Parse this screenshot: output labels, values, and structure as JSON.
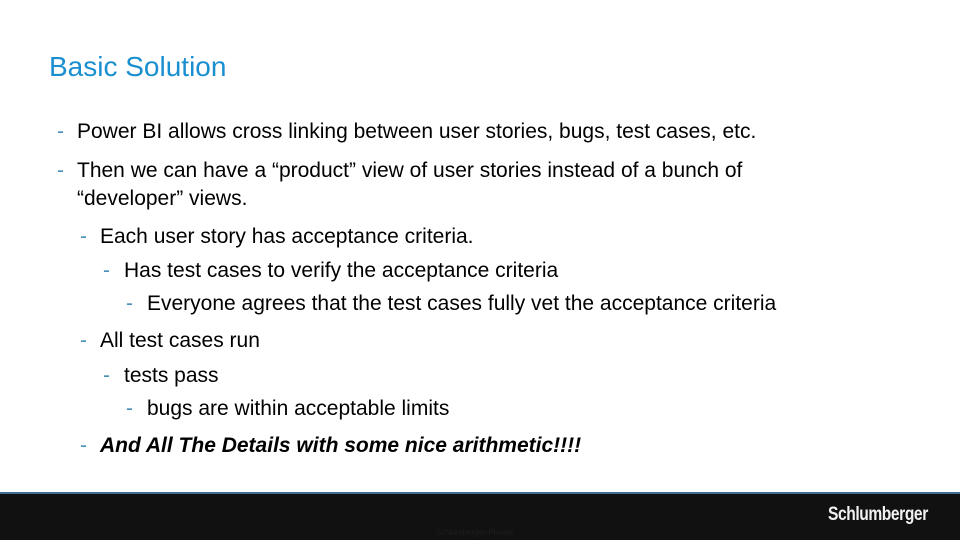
{
  "slide": {
    "title": "Basic Solution",
    "bullet_marker": "-",
    "bullets": [
      {
        "level": 1,
        "text": "Power BI allows cross linking between user stories, bugs, test cases, etc."
      },
      {
        "level": 1,
        "text": "Then we can have a “product” view of user stories instead of a bunch of",
        "continuation": "“developer” views."
      },
      {
        "level": 2,
        "text": "Each user story has acceptance criteria."
      },
      {
        "level": 3,
        "text": "Has test cases to verify the acceptance criteria"
      },
      {
        "level": 4,
        "text": "Everyone agrees that the test cases fully vet the acceptance criteria"
      },
      {
        "level": 2,
        "text": "All test cases run"
      },
      {
        "level": 3,
        "text": "tests pass"
      },
      {
        "level": 4,
        "text": "bugs are within acceptable limits"
      },
      {
        "level": 2,
        "text": "And All The Details with some nice arithmetic!!!!",
        "style": "bold-italic"
      }
    ]
  },
  "footer": {
    "classification": "Schlumberger-Private",
    "logo_text": "Schlumberger"
  },
  "colors": {
    "title": "#1a8fd0",
    "bullet_marker": "#4a90b8",
    "footer_bg": "#111111",
    "footer_line": "#3d6d92"
  }
}
